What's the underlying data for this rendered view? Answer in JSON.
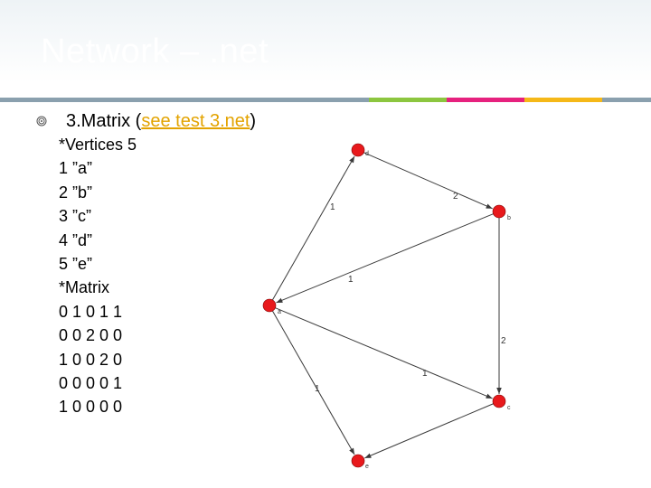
{
  "slide": {
    "title": "Network – .net",
    "accent_colors": [
      "#8aa0ae",
      "#8cc63f",
      "#e6217e",
      "#f5b818",
      "#8aa0ae"
    ],
    "bullet": {
      "prefix": "3.Matrix (",
      "link_text": "see test 3.net",
      "suffix": ")"
    },
    "pajek_lines": [
      "*Vertices 5",
      "1 ”a”",
      "2 ”b”",
      "3 ”c”",
      "4 ”d”",
      "5 ”e”",
      "*Matrix",
      "0 1 0 1 1",
      "0 0 2 0 0",
      "1 0 0 2 0",
      "0 0 0 0 1",
      "1 0 0 0 0"
    ]
  },
  "diagram": {
    "node_color": "#e8191c",
    "edge_color": "#3a3a3a",
    "nodes": [
      {
        "id": "d",
        "label": "d"
      },
      {
        "id": "b",
        "label": "b"
      },
      {
        "id": "a",
        "label": "a"
      },
      {
        "id": "c",
        "label": "c"
      },
      {
        "id": "e",
        "label": "e"
      }
    ],
    "edges": [
      {
        "from": "d",
        "to": "b",
        "label": "2"
      },
      {
        "from": "a",
        "to": "d",
        "label": "1"
      },
      {
        "from": "b",
        "to": "a",
        "label": "1"
      },
      {
        "from": "b",
        "to": "c",
        "label": "2"
      },
      {
        "from": "a",
        "to": "c",
        "label": "1"
      },
      {
        "from": "a",
        "to": "e",
        "label": "1"
      },
      {
        "from": "c",
        "to": "e",
        "label": ""
      }
    ]
  }
}
